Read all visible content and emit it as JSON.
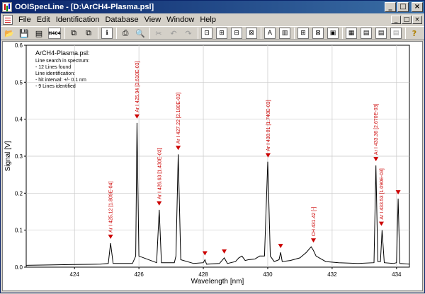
{
  "window": {
    "title": "OOISpecLine - [D:\\ArCH4-Plasma.psl]",
    "buttons": {
      "minimize": "_",
      "maximize": "□",
      "close": "×"
    }
  },
  "menu": [
    "File",
    "Edit",
    "Identification",
    "Database",
    "View",
    "Window",
    "Help"
  ],
  "toolbar": {
    "items": [
      {
        "name": "open-icon",
        "glyph": "📂"
      },
      {
        "name": "save-icon",
        "glyph": "💾"
      },
      {
        "name": "export-icon",
        "glyph": "▤"
      },
      {
        "name": "h404-icon",
        "glyph": "H404"
      },
      {
        "name": "copy-spectrum-icon",
        "glyph": "⧉"
      },
      {
        "name": "paste-spectrum-icon",
        "glyph": "⧉"
      },
      {
        "name": "info-icon",
        "glyph": "ℹ"
      },
      {
        "name": "print-icon",
        "glyph": "⎙"
      },
      {
        "name": "print-preview-icon",
        "glyph": "🔍"
      },
      {
        "name": "cut-icon",
        "glyph": "✂"
      },
      {
        "name": "undo-icon",
        "glyph": "↶"
      },
      {
        "name": "redo-icon",
        "glyph": "↷"
      },
      {
        "name": "zoom-region-icon",
        "glyph": "⊡"
      },
      {
        "name": "zoom-x-icon",
        "glyph": "⊞"
      },
      {
        "name": "zoom-y-icon",
        "glyph": "⊟"
      },
      {
        "name": "zoom-full-icon",
        "glyph": "⊠"
      },
      {
        "name": "label-icon",
        "glyph": "A"
      },
      {
        "name": "peak-bars-icon",
        "glyph": "▥"
      },
      {
        "name": "grid-icon",
        "glyph": "⊞"
      },
      {
        "name": "cross-icon",
        "glyph": "⊠"
      },
      {
        "name": "area-icon",
        "glyph": "▣"
      },
      {
        "name": "spectrum-view-icon",
        "glyph": "▦"
      },
      {
        "name": "line-chart-icon",
        "glyph": "▤"
      },
      {
        "name": "line-chart-2-icon",
        "glyph": "▤"
      },
      {
        "name": "line-chart-3-icon",
        "glyph": "▤"
      },
      {
        "name": "help-icon",
        "glyph": "?"
      }
    ]
  },
  "info_box": [
    "ArCH4-Plasma.psl:",
    "Line search in spectrum:",
    "- 12 Lines found",
    "Line identification:",
    "- hit interval: +/- 0.1 nm",
    "- 9 Lines identified"
  ],
  "chart_data": {
    "type": "line",
    "xlabel": "Wavelength [nm]",
    "ylabel": "Signal [V]",
    "xlim": [
      422.5,
      434.4
    ],
    "ylim": [
      0,
      0.6
    ],
    "xticks": [
      424,
      426,
      428,
      430,
      432,
      434
    ],
    "yticks": [
      0,
      0.1,
      0.2,
      0.3,
      0.4,
      0.5,
      0.6
    ],
    "ytick_labels": [
      "0.0",
      "0.1",
      "0.2",
      "0.3",
      "0.4",
      "0.5",
      "0.6"
    ],
    "grid": true,
    "series": [
      {
        "values": [
          [
            422.5,
            0.005
          ],
          [
            423.2,
            0.006
          ],
          [
            424.0,
            0.007
          ],
          [
            424.8,
            0.008
          ],
          [
            425.05,
            0.01
          ],
          [
            425.12,
            0.065
          ],
          [
            425.2,
            0.01
          ],
          [
            425.8,
            0.01
          ],
          [
            425.9,
            0.03
          ],
          [
            425.94,
            0.39
          ],
          [
            426.0,
            0.03
          ],
          [
            426.55,
            0.012
          ],
          [
            426.63,
            0.155
          ],
          [
            426.7,
            0.012
          ],
          [
            427.1,
            0.012
          ],
          [
            427.15,
            0.03
          ],
          [
            427.22,
            0.305
          ],
          [
            427.3,
            0.02
          ],
          [
            427.7,
            0.01
          ],
          [
            428.0,
            0.012
          ],
          [
            428.05,
            0.02
          ],
          [
            428.1,
            0.008
          ],
          [
            428.5,
            0.01
          ],
          [
            428.65,
            0.025
          ],
          [
            428.75,
            0.01
          ],
          [
            429.0,
            0.015
          ],
          [
            429.1,
            0.025
          ],
          [
            429.2,
            0.03
          ],
          [
            429.3,
            0.018
          ],
          [
            429.4,
            0.02
          ],
          [
            429.6,
            0.022
          ],
          [
            429.75,
            0.03
          ],
          [
            429.9,
            0.03
          ],
          [
            430.0,
            0.285
          ],
          [
            430.08,
            0.03
          ],
          [
            430.2,
            0.015
          ],
          [
            430.35,
            0.02
          ],
          [
            430.4,
            0.04
          ],
          [
            430.45,
            0.015
          ],
          [
            430.7,
            0.018
          ],
          [
            431.0,
            0.025
          ],
          [
            431.2,
            0.04
          ],
          [
            431.35,
            0.055
          ],
          [
            431.42,
            0.045
          ],
          [
            431.5,
            0.03
          ],
          [
            431.8,
            0.015
          ],
          [
            432.2,
            0.012
          ],
          [
            432.8,
            0.01
          ],
          [
            433.3,
            0.012
          ],
          [
            433.36,
            0.275
          ],
          [
            433.42,
            0.015
          ],
          [
            433.5,
            0.015
          ],
          [
            433.55,
            0.1
          ],
          [
            433.62,
            0.012
          ],
          [
            433.9,
            0.01
          ],
          [
            434.0,
            0.012
          ],
          [
            434.05,
            0.185
          ],
          [
            434.1,
            0.01
          ],
          [
            434.4,
            0.008
          ]
        ]
      }
    ],
    "annotations": [
      {
        "x": 425.12,
        "y": 0.065,
        "label": "Ar I  425.12 [1.809E-04]"
      },
      {
        "x": 425.94,
        "y": 0.39,
        "label": "Ar I  425.94 [3.610E-03]"
      },
      {
        "x": 426.63,
        "y": 0.155,
        "label": "Ar I  426.63 [1.430E-03]"
      },
      {
        "x": 427.22,
        "y": 0.305,
        "label": "Ar I  427.22 [2.180E-03]"
      },
      {
        "x": 430.01,
        "y": 0.285,
        "label": "Ar I  430.01 [1.740E-03]"
      },
      {
        "x": 431.42,
        "y": 0.055,
        "label": "CH  431.42 [-]"
      },
      {
        "x": 433.36,
        "y": 0.275,
        "label": "Ar I  433.36 [2.670E-03]"
      },
      {
        "x": 433.53,
        "y": 0.1,
        "label": "Ar I  433.53 [1.090E-03]"
      }
    ],
    "unlabeled_peaks": [
      {
        "x": 428.05,
        "y": 0.02
      },
      {
        "x": 428.65,
        "y": 0.025
      },
      {
        "x": 430.4,
        "y": 0.04
      },
      {
        "x": 434.05,
        "y": 0.185
      }
    ],
    "colors": {
      "line": "#000000",
      "marker": "#cc0000",
      "label": "#cc0000",
      "grid": "#c8c8c8"
    }
  }
}
